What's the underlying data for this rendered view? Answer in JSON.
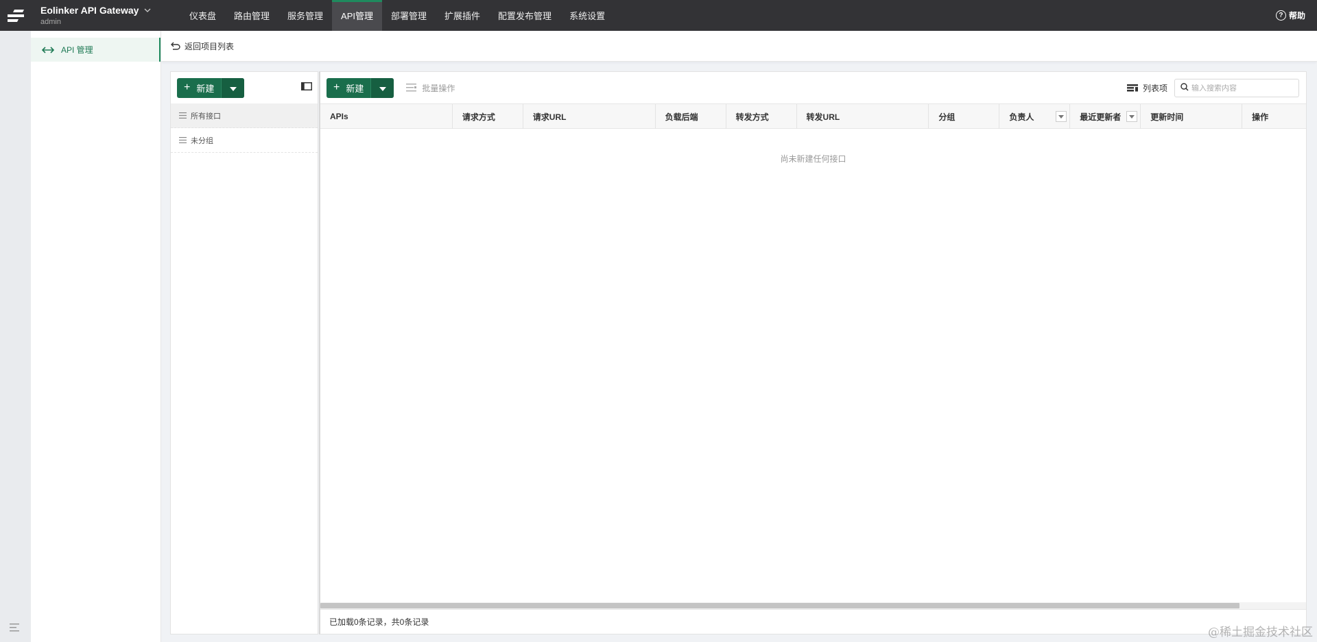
{
  "header": {
    "logo_icon": "gateway-logo-icon",
    "brand_title": "Eolinker API Gateway",
    "brand_user": "admin",
    "nav": [
      {
        "label": "仪表盘",
        "active": false
      },
      {
        "label": "路由管理",
        "active": false
      },
      {
        "label": "服务管理",
        "active": false
      },
      {
        "label": "API管理",
        "active": true
      },
      {
        "label": "部署管理",
        "active": false
      },
      {
        "label": "扩展插件",
        "active": false
      },
      {
        "label": "配置发布管理",
        "active": false
      },
      {
        "label": "系统设置",
        "active": false
      }
    ],
    "help_label": "帮助"
  },
  "sidebar": {
    "items": [
      {
        "label": "API 管理",
        "icon": "api-arrows-icon",
        "active": true
      }
    ]
  },
  "breadcrumb": {
    "back_label": "返回项目列表"
  },
  "group_panel": {
    "new_label": "新建",
    "items": [
      {
        "label": "所有接口",
        "active": true
      },
      {
        "label": "未分组",
        "active": false
      }
    ]
  },
  "api_panel": {
    "new_label": "新建",
    "batch_label": "批量操作",
    "columns_label": "列表项",
    "search_placeholder": "输入搜索内容",
    "columns": [
      "APIs",
      "请求方式",
      "请求URL",
      "负载后端",
      "转发方式",
      "转发URL",
      "分组",
      "负责人",
      "最近更新者",
      "更新时间",
      "操作"
    ],
    "empty_text": "尚未新建任何接口",
    "footer_text": "已加载0条记录，共0条记录"
  },
  "watermark": "@稀土掘金技术社区",
  "colors": {
    "accent": "#1a6e4c",
    "topbar": "#333336"
  }
}
